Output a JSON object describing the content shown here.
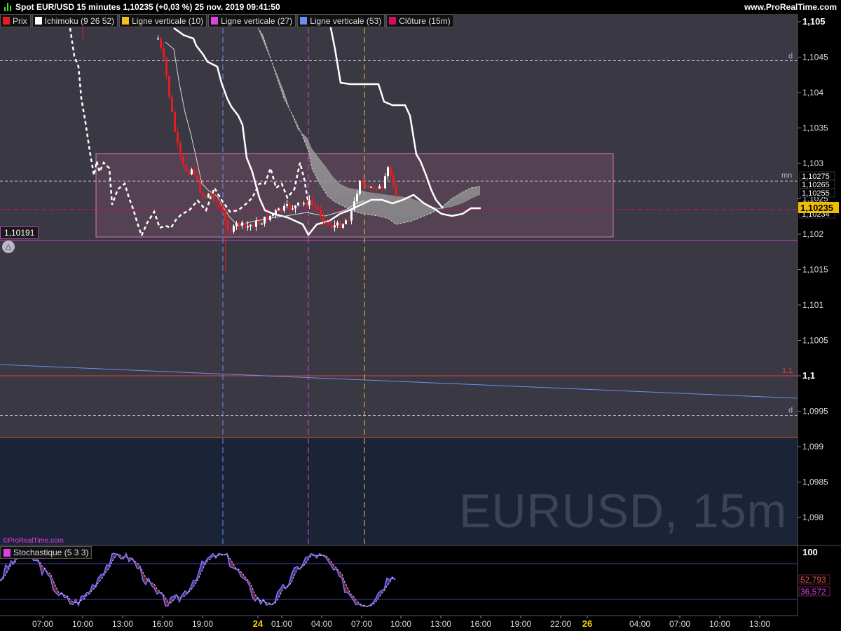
{
  "header": {
    "title": "Spot EUR/USD 15 minutes 1,10235 (+0,03 %) 25 nov. 2019 09:41:50",
    "site": "www.ProRealTime.com"
  },
  "legend": [
    {
      "label": "Prix",
      "color": "#e02020"
    },
    {
      "label": "Ichimoku (9 26 52)",
      "color": "#ffffff"
    },
    {
      "label": "Ligne verticale (10)",
      "color": "#f0c020"
    },
    {
      "label": "Ligne verticale (27)",
      "color": "#e040e0"
    },
    {
      "label": "Ligne verticale (53)",
      "color": "#6a8ff0"
    },
    {
      "label": "Clôture (15m)",
      "color": "#d01060"
    }
  ],
  "watermark": "EURUSD, 15m",
  "copyright": "©ProRealTime.com",
  "ref_level_label": "1,10191",
  "price_axis": {
    "labels": [
      "1,105",
      "1,1045",
      "1,104",
      "1,1035",
      "1,103",
      "1,1025",
      "1,102",
      "1,1015",
      "1,101",
      "1,1005",
      "1,1",
      "1,0995",
      "1,099",
      "1,0985",
      "1,098"
    ],
    "min": 1.0977,
    "max": 1.1052
  },
  "markers": {
    "current_price": "1,10235",
    "tags": [
      "1,10275",
      "1,10265",
      "1,10255",
      "1,10234"
    ],
    "line_labels": {
      "d_upper": "d",
      "mn": "mn",
      "level_1_1": "1,1",
      "d_lower": "d"
    }
  },
  "time_axis": {
    "labels": [
      "07:00",
      "10:00",
      "13:00",
      "16:00",
      "19:00",
      "24",
      "01:00",
      "04:00",
      "07:00",
      "10:00",
      "13:00",
      "16:00",
      "19:00",
      "22:00",
      "26",
      "04:00",
      "07:00",
      "10:00",
      "13:00"
    ],
    "bold": [
      "24",
      "26"
    ]
  },
  "stochastic": {
    "label": "Stochastique (5 3 3)",
    "axis_top": "100",
    "k_value": "52,793",
    "d_value": "36,572",
    "color_k": "#8a6cff",
    "color_d": "#d0d0ff",
    "band_upper": 80,
    "band_lower": 20
  },
  "chart_data": {
    "type": "line",
    "symbol": "EUR/USD",
    "timeframe": "15 minutes",
    "last_price": 1.10235,
    "change_pct": 0.03,
    "series": [
      {
        "name": "Prix",
        "values": [
          1.1055,
          1.1048,
          1.1042,
          1.1036,
          1.1031,
          1.1028,
          1.1027,
          1.1023,
          1.1021,
          1.1024,
          1.1022,
          1.1019,
          1.1021,
          1.102,
          1.1021,
          1.1022,
          1.1023,
          1.1024,
          1.1025,
          1.1024,
          1.1022,
          1.1021,
          1.102,
          1.1021,
          1.1023,
          1.1026,
          1.1027,
          1.1026,
          1.1028,
          1.1025,
          1.10235
        ]
      },
      {
        "name": "Ichimoku (9 26 52)",
        "values": [
          1.106,
          1.1058,
          1.1053,
          1.1046,
          1.104,
          1.1034,
          1.103,
          1.1027,
          1.1025,
          1.1023,
          1.1023,
          1.1022,
          1.1022,
          1.1022,
          1.1022,
          1.1023,
          1.1023,
          1.1023,
          1.1023,
          1.1023,
          1.1025,
          1.1026,
          1.1026,
          1.1026,
          1.1026,
          1.1026,
          1.1026,
          1.1026,
          1.1026,
          1.10235,
          1.10235
        ]
      }
    ],
    "levels": {
      "d_upper": 1.10445,
      "mn": 1.10275,
      "close_15m": 1.10235,
      "support": 1.10191,
      "level_1_1": 1.1,
      "d_lower": 1.09944,
      "lower": 1.09913
    },
    "range_box": {
      "high": 1.10314,
      "low": 1.10196
    },
    "vertical_lines": [
      {
        "name": "Ligne verticale (53)",
        "time": "20:00"
      },
      {
        "name": "Ligne verticale (27)",
        "time": "03:00"
      },
      {
        "name": "Ligne verticale (10)",
        "time": "07:00"
      }
    ],
    "stochastic": {
      "k_last": 52.793,
      "d_last": 36.572,
      "ylim": [
        0,
        100
      ]
    }
  }
}
